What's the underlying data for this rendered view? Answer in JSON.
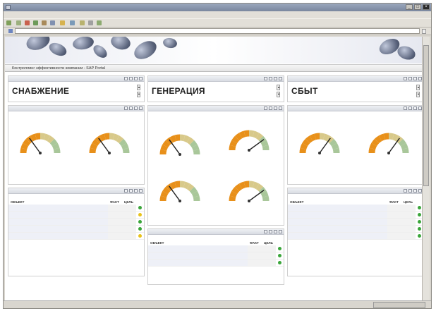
{
  "browser": {
    "title": "",
    "menu": [
      "",
      "",
      "",
      "",
      "",
      ""
    ],
    "toolbar": [
      "",
      "",
      "",
      "",
      ""
    ],
    "address_label": "",
    "url": "",
    "go": "",
    "status": "",
    "zone": ""
  },
  "portal": {
    "title": "Контроллинг эффективности компании - SAP Portal",
    "links": [
      "",
      "",
      "",
      ""
    ]
  },
  "columns": [
    {
      "header": "",
      "title": "СНАБЖЕНИЕ",
      "kpi_panel": {
        "header": "",
        "period": "",
        "gauges": [
          {
            "title": "",
            "label": "",
            "value": 0.3,
            "color": "#e8901a"
          },
          {
            "title": "",
            "label": "",
            "value": 0.3,
            "color": "#e8901a"
          }
        ],
        "footer": ""
      },
      "table_panel": {
        "header": "",
        "period": "",
        "cols": [
          "ОБЪЕКТ",
          "ФАКТ",
          "ЦЕЛЬ"
        ],
        "rows": [
          {
            "name": "",
            "fact": "",
            "goal": "",
            "status": "green"
          },
          {
            "name": "",
            "fact": "",
            "goal": "",
            "status": "yellow"
          },
          {
            "name": "",
            "fact": "",
            "goal": "",
            "status": "green"
          },
          {
            "name": "",
            "fact": "",
            "goal": "",
            "status": "green"
          },
          {
            "name": "",
            "fact": "",
            "goal": "",
            "status": "yellow"
          }
        ],
        "footer": ""
      }
    },
    {
      "header": "",
      "title": "ГЕНЕРАЦИЯ",
      "kpi_panel": {
        "header": "",
        "period": "",
        "gauges": [
          {
            "title": "",
            "label": "",
            "value": 0.3,
            "color": "#e8901a"
          },
          {
            "title": "",
            "label": "",
            "value": 0.8,
            "color": "#e8901a"
          },
          {
            "title": "",
            "label": "",
            "value": 0.3,
            "color": "#e8901a"
          },
          {
            "title": "",
            "label": "",
            "value": 0.8,
            "color": "#e8901a"
          }
        ],
        "footer": ""
      },
      "table_panel": {
        "header": "",
        "period": "",
        "cols": [
          "ОБЪЕКТ",
          "ФАКТ",
          "ЦЕЛЬ"
        ],
        "rows": [
          {
            "name": "",
            "fact": "",
            "goal": "",
            "status": "green"
          },
          {
            "name": "",
            "fact": "",
            "goal": "",
            "status": "green"
          },
          {
            "name": "",
            "fact": "",
            "goal": "",
            "status": "green"
          }
        ],
        "footer": ""
      }
    },
    {
      "header": "",
      "title": "СБЫТ",
      "kpi_panel": {
        "header": "",
        "period": "",
        "gauges": [
          {
            "title": "",
            "label": "",
            "value": 0.7,
            "color": "#e8901a"
          },
          {
            "title": "",
            "label": "",
            "value": 0.7,
            "color": "#e8901a"
          }
        ],
        "footer": ""
      },
      "table_panel": {
        "header": "",
        "period": "",
        "cols": [
          "ОБЪЕКТ",
          "ФАКТ",
          "ЦЕЛЬ"
        ],
        "rows": [
          {
            "name": "",
            "fact": "",
            "goal": "",
            "status": "green"
          },
          {
            "name": "",
            "fact": "",
            "goal": "",
            "status": "green"
          },
          {
            "name": "",
            "fact": "",
            "goal": "",
            "status": "green"
          },
          {
            "name": "",
            "fact": "",
            "goal": "",
            "status": "green"
          },
          {
            "name": "",
            "fact": "",
            "goal": "",
            "status": "green"
          }
        ],
        "footer": ""
      }
    }
  ],
  "status_colors": {
    "green": "#3aa53a",
    "yellow": "#e8c21a",
    "red": "#d33"
  }
}
